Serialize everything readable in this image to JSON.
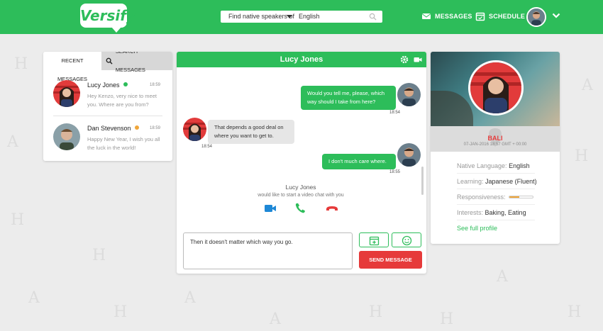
{
  "header": {
    "logo": "Versify",
    "search_select": "Find native speakers of",
    "search_value": "English",
    "nav_messages": "MESSAGES",
    "nav_schedule": "SCHEDULE"
  },
  "sidebar": {
    "tabs": [
      "RECENT MESSAGES",
      "SEARCH MESSAGES"
    ],
    "conversations": [
      {
        "name": "Lucy Jones",
        "status_color": "#2dbd5a",
        "time": "18:59",
        "preview": "Hey Kenzo, very nice to meet you. Where are you from?"
      },
      {
        "name": "Dan Stevenson",
        "status_color": "#f0a63a",
        "time": "18:59",
        "preview": "Happy New Year, I wish you all the luck in the world!"
      }
    ]
  },
  "chat": {
    "title": "Lucy Jones",
    "messages": [
      {
        "direction": "out",
        "text": "Would you tell me, please, which way should I take from here?",
        "time": "18:54"
      },
      {
        "direction": "in",
        "text": "That depends a good deal on where you want to get to.",
        "time": "18:54"
      },
      {
        "direction": "out",
        "text": "I don't much care where.",
        "time": "18:55"
      }
    ],
    "video_request": {
      "name": "Lucy Jones",
      "text": "would like to start a video chat with you"
    },
    "compose_text": "Then it doesn't matter which way you go.",
    "send_label": "SEND MESSAGE"
  },
  "profile": {
    "location": "BALI",
    "datetime": "07-JAN-2016   18:57   GMT + 00:00",
    "native_label": "Native Language:",
    "native_value": "English",
    "learning_label": "Learning:",
    "learning_value": "Japanese (Fluent)",
    "responsiveness_label": "Responsiveness:",
    "responsiveness": 0.45,
    "interests_label": "Interests:",
    "interests_value": "Baking, Eating",
    "see_profile": "See full profile"
  },
  "colors": {
    "brand_green": "#2dbd5a",
    "send_red": "#e63a3a",
    "accent_orange": "#f0a63a",
    "video_blue": "#1e88d6"
  }
}
